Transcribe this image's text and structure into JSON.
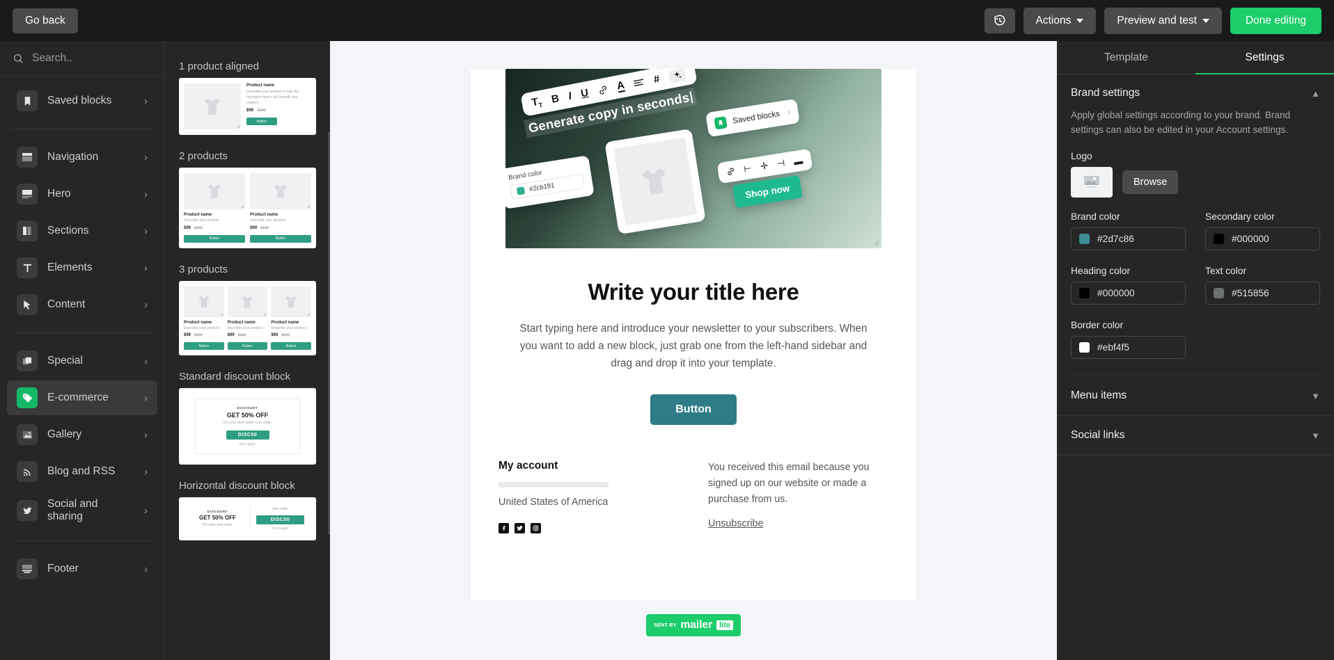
{
  "topbar": {
    "go_back": "Go back",
    "history_icon": "history-clock-icon",
    "actions": "Actions",
    "preview": "Preview and test",
    "done": "Done editing",
    "primary_color": "#1ccd6a"
  },
  "sidebar": {
    "search_placeholder": "Search..",
    "search_icon": "search-icon",
    "groups": [
      {
        "items": [
          {
            "label": "Saved blocks",
            "icon": "bookmark-icon",
            "active": false
          }
        ]
      },
      {
        "items": [
          {
            "label": "Navigation",
            "icon": "navigation-block-icon",
            "active": false
          },
          {
            "label": "Hero",
            "icon": "hero-block-icon",
            "active": false
          },
          {
            "label": "Sections",
            "icon": "sections-block-icon",
            "active": false
          },
          {
            "label": "Elements",
            "icon": "text-element-icon",
            "active": false
          },
          {
            "label": "Content",
            "icon": "cursor-icon",
            "active": false
          }
        ]
      },
      {
        "items": [
          {
            "label": "Special",
            "icon": "layers-icon",
            "active": false
          },
          {
            "label": "E-commerce",
            "icon": "price-tag-icon",
            "active": true
          },
          {
            "label": "Gallery",
            "icon": "image-icon",
            "active": false
          },
          {
            "label": "Blog and RSS",
            "icon": "rss-icon",
            "active": false
          },
          {
            "label": "Social and sharing",
            "icon": "twitter-bird-icon",
            "active": false
          }
        ]
      },
      {
        "items": [
          {
            "label": "Footer",
            "icon": "footer-block-icon",
            "active": false
          }
        ]
      }
    ]
  },
  "blockpanel": {
    "sections": [
      {
        "title": "1 product aligned",
        "type": "product",
        "columns": 1
      },
      {
        "title": "2 products",
        "type": "product",
        "columns": 2
      },
      {
        "title": "3 products",
        "type": "product",
        "columns": 3
      },
      {
        "title": "Standard discount block",
        "type": "discount-vertical"
      },
      {
        "title": "Horizontal discount block",
        "type": "discount-horizontal"
      }
    ],
    "product_card": {
      "name": "Product name",
      "description": "Describe your product in way the highlights how it will benefit your readers.",
      "description_short": "Describe your product.",
      "price": "$99",
      "old_price": "$129",
      "button": "Button"
    },
    "discount_card": {
      "eyebrow": "DISCOUNT",
      "headline": "GET 50% OFF",
      "subtext": "On your next order. Use code:",
      "subtext_short": "On your next order",
      "code": "DISC50",
      "terms": "T&C's apply*",
      "use_code": "Use code:"
    }
  },
  "email": {
    "hero": {
      "toolbar_icons": [
        "Tт",
        "B",
        "I",
        "U",
        "link-icon",
        "A",
        "align-icon",
        "#",
        "sparkle-icon"
      ],
      "generate_text": "Generate copy in seconds",
      "brand_color_label": "Brand color",
      "brand_color_value": "#2cb191",
      "saved_blocks_label": "Saved blocks",
      "shop_now_label": "Shop now"
    },
    "title": "Write your title here",
    "body": "Start typing here and introduce your newsletter to your subscribers. When you want to add a new block, just grab one from the left-hand sidebar and drag and drop it into your template.",
    "button": "Button",
    "button_color": "#2d7c86",
    "footer": {
      "account_heading": "My account",
      "country": "United States of America",
      "socials": [
        "facebook-icon",
        "twitter-icon",
        "instagram-icon"
      ],
      "reason": "You received this email because you signed up on our website or made a purchase from us.",
      "unsubscribe": "Unsubscribe"
    },
    "sent_by": {
      "prefix": "SENT BY",
      "brand": "mailer",
      "suffix": "lite"
    }
  },
  "settings": {
    "tabs": [
      {
        "label": "Template",
        "active": false
      },
      {
        "label": "Settings",
        "active": true
      }
    ],
    "brand": {
      "title": "Brand settings",
      "description": "Apply global settings according to your brand. Brand settings can also be edited in your Account settings.",
      "logo_label": "Logo",
      "logo_icon": "image-placeholder-icon",
      "browse": "Browse",
      "colors": [
        {
          "label": "Brand color",
          "value": "#2d7c86",
          "swatch": "#3c8b95"
        },
        {
          "label": "Secondary color",
          "value": "#000000",
          "swatch": "#000000"
        },
        {
          "label": "Heading color",
          "value": "#000000",
          "swatch": "#000000"
        },
        {
          "label": "Text color",
          "value": "#515856",
          "swatch": "#6b716f"
        },
        {
          "label": "Border color",
          "value": "#ebf4f5",
          "swatch": "#ffffff"
        }
      ]
    },
    "collapsed_sections": [
      {
        "label": "Menu items"
      },
      {
        "label": "Social links"
      }
    ]
  }
}
